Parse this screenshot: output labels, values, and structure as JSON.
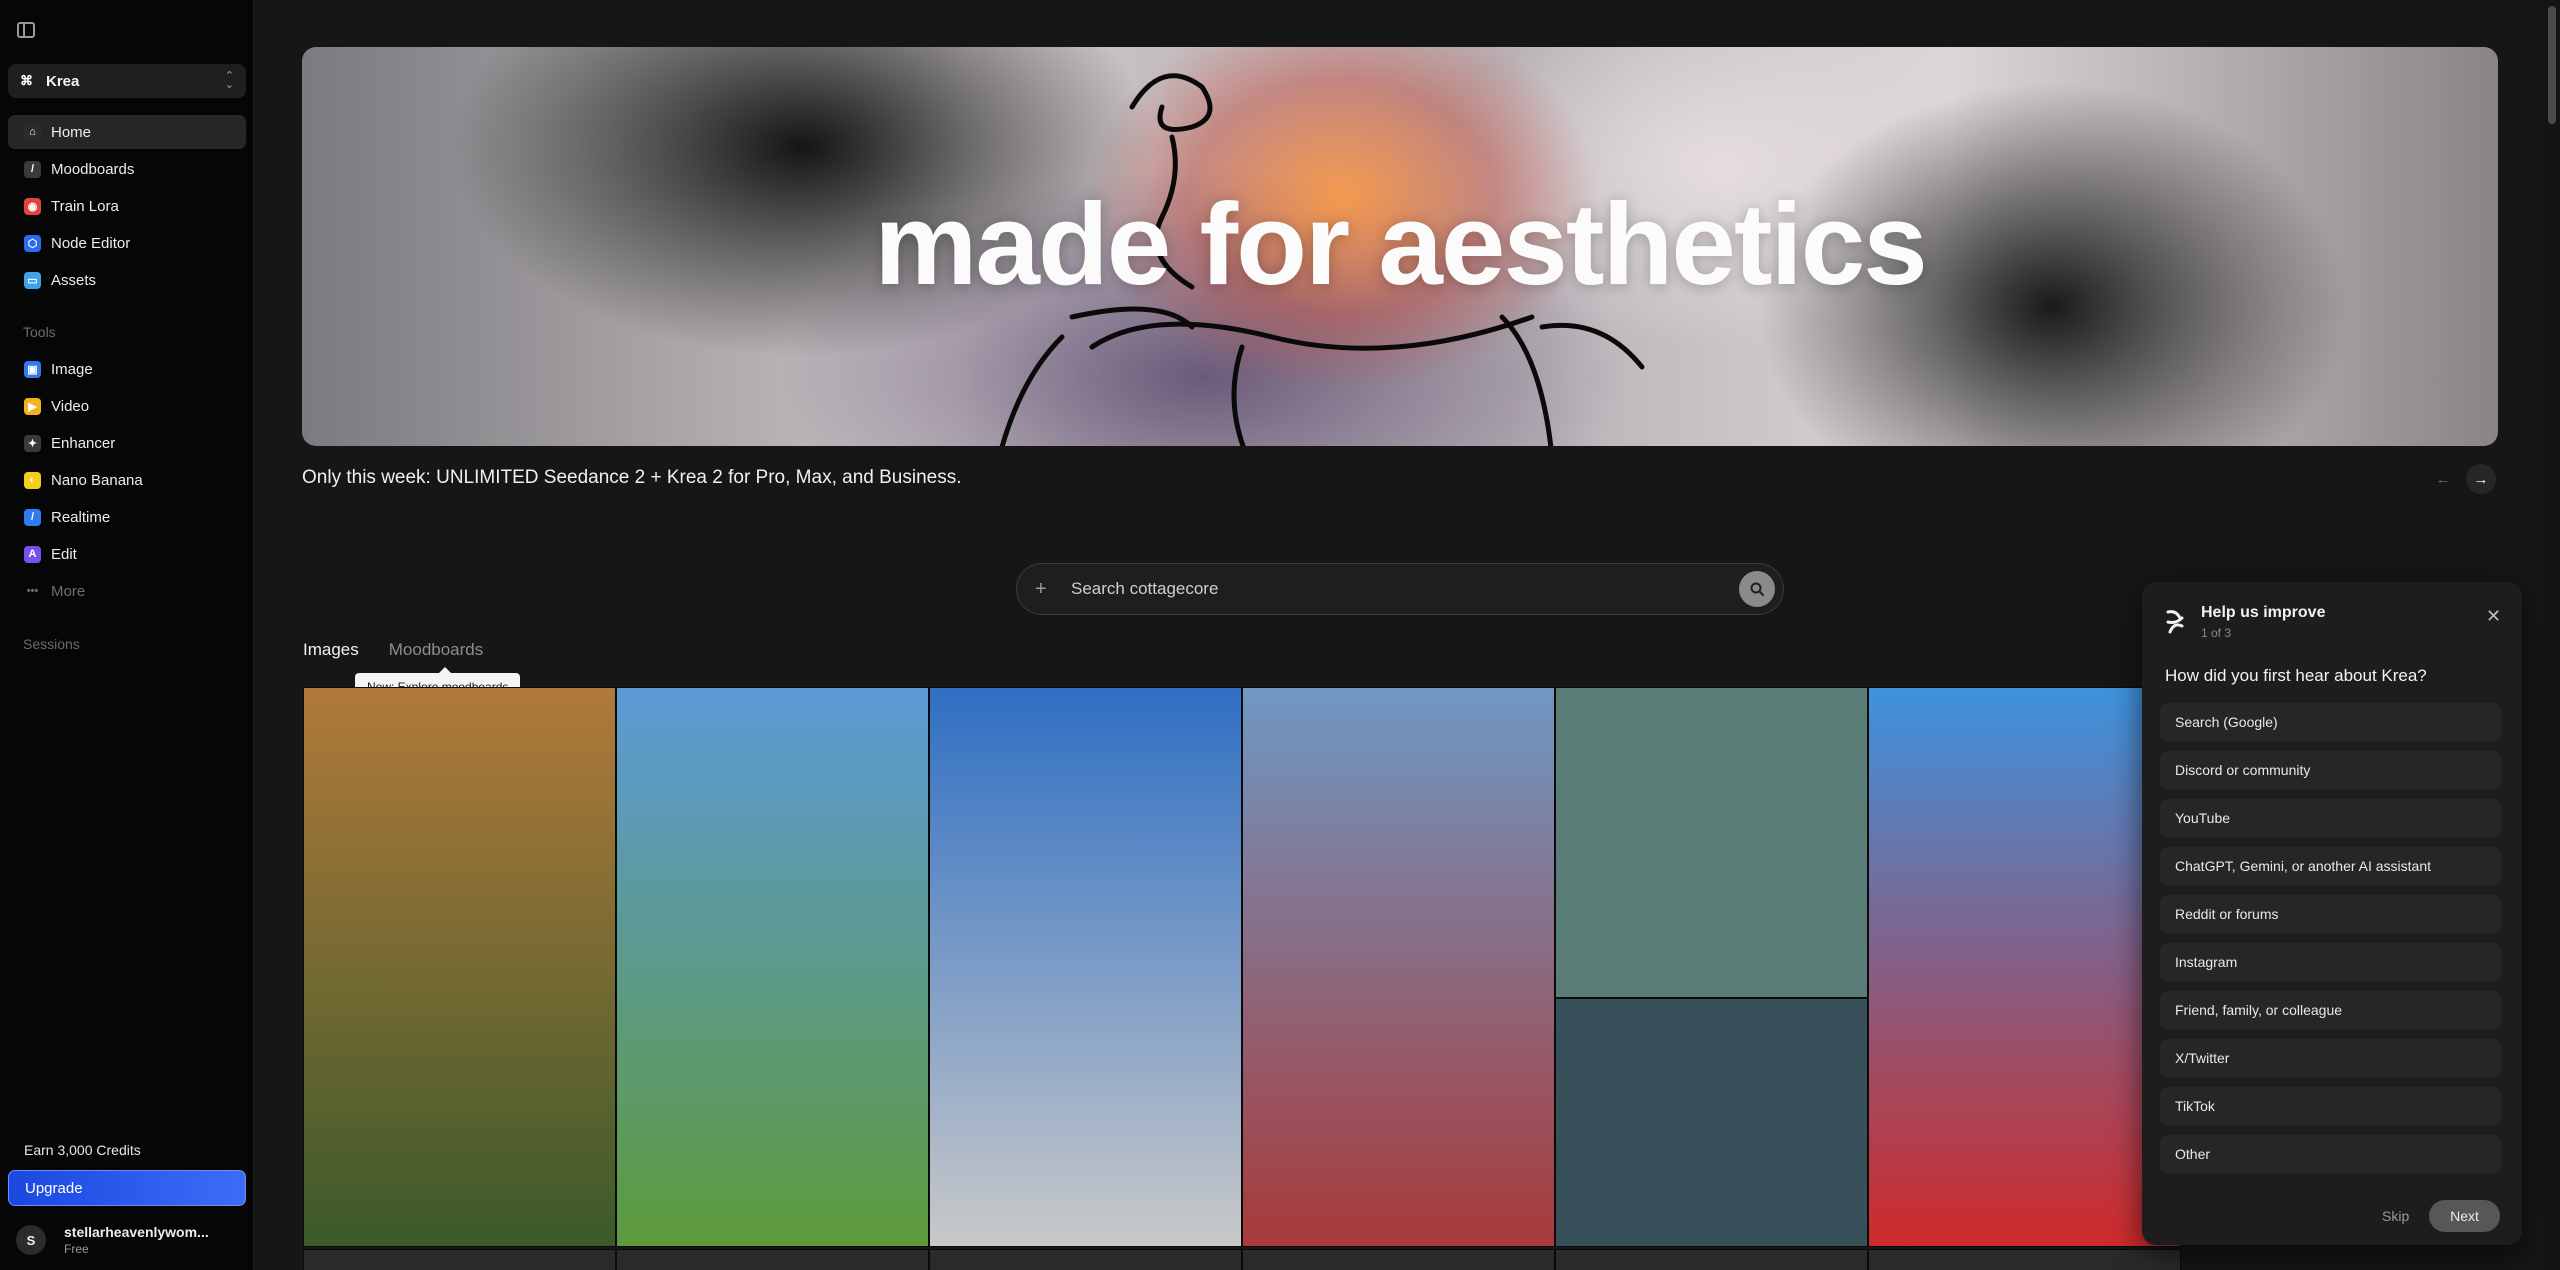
{
  "sidebar": {
    "workspace": "Krea",
    "nav": [
      {
        "label": "Home",
        "icon": "home-icon",
        "color": "#2b2b2b",
        "glyph": "⌂"
      },
      {
        "label": "Moodboards",
        "icon": "moodboard-icon",
        "color": "#3a3a3a",
        "glyph": "/"
      },
      {
        "label": "Train Lora",
        "icon": "train-lora-icon",
        "color": "#e0443e",
        "glyph": "◉"
      },
      {
        "label": "Node Editor",
        "icon": "node-editor-icon",
        "color": "#2a6cf0",
        "glyph": "⬡"
      },
      {
        "label": "Assets",
        "icon": "folder-icon",
        "color": "#3ea3e8",
        "glyph": "▭"
      }
    ],
    "tools_label": "Tools",
    "tools": [
      {
        "label": "Image",
        "icon": "image-icon",
        "color": "#2f7cf0",
        "glyph": "▣"
      },
      {
        "label": "Video",
        "icon": "video-icon",
        "color": "#f2b320",
        "glyph": "▶"
      },
      {
        "label": "Enhancer",
        "icon": "enhancer-icon",
        "color": "#3a3a3a",
        "glyph": "✦"
      },
      {
        "label": "Nano Banana",
        "icon": "banana-icon",
        "color": "#f5cf1c",
        "glyph": "◐"
      },
      {
        "label": "Realtime",
        "icon": "realtime-icon",
        "color": "#2f7cf0",
        "glyph": "/"
      },
      {
        "label": "Edit",
        "icon": "edit-icon",
        "color": "#7a4ff0",
        "glyph": "A"
      }
    ],
    "more_label": "More",
    "sessions_label": "Sessions",
    "earn_label": "Earn 3,000 Credits",
    "upgrade_label": "Upgrade",
    "user": {
      "initial": "S",
      "name": "stellarheavenlywom...",
      "plan": "Free"
    }
  },
  "hero": {
    "title": "made for aesthetics"
  },
  "promo": {
    "text": "Only this week: UNLIMITED Seedance 2 + Krea 2 for Pro, Max, and Business."
  },
  "search": {
    "placeholder": "Search cottagecore"
  },
  "tabs": {
    "images": "Images",
    "moodboards": "Moodboards",
    "tooltip": "New: Explore moodboards"
  },
  "gallery_colors": [
    [
      "#b07a3a",
      "#3b5a2a"
    ],
    [
      "#5c9ad8",
      "#5d9a3c"
    ],
    [
      "#2f6fc4",
      "#c9c9c9"
    ],
    [
      "#6f98c4",
      "#a83a3a"
    ],
    [
      "#5b7d78",
      "#38505a"
    ],
    [
      "#3d93de",
      "#cf2a2a"
    ]
  ],
  "survey": {
    "title": "Help us improve",
    "step": "1 of 3",
    "question": "How did you first hear about Krea?",
    "options": [
      "Search (Google)",
      "Discord or community",
      "YouTube",
      "ChatGPT, Gemini, or another AI assistant",
      "Reddit or forums",
      "Instagram",
      "Friend, family, or colleague",
      "X/Twitter",
      "TikTok",
      "Other"
    ],
    "skip_label": "Skip",
    "next_label": "Next"
  }
}
